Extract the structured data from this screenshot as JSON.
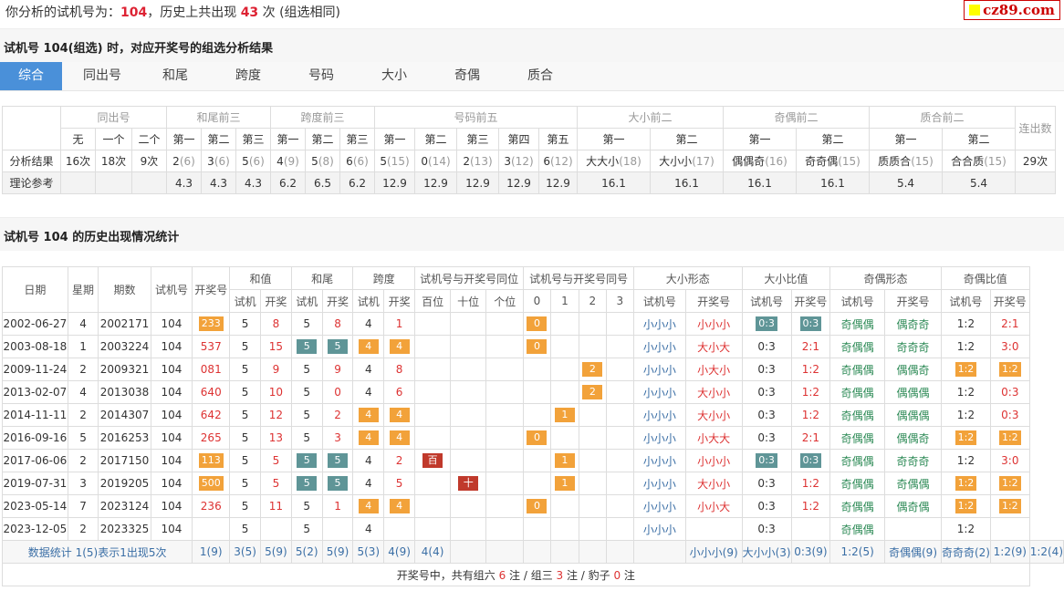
{
  "header": {
    "prefix": "你分析的试机号为：",
    "num": "104",
    "mid": "，历史上共出现 ",
    "count": "43",
    "suffix": " 次 (组选相同)"
  },
  "logo": "cz89.com",
  "section1_title": "试机号 104(组选) 时，对应开奖号的组选分析结果",
  "tabs": [
    "综合",
    "同出号",
    "和尾",
    "跨度",
    "号码",
    "大小",
    "奇偶",
    "质合"
  ],
  "analysis": {
    "groups": [
      "同出号",
      "和尾前三",
      "跨度前三",
      "号码前五",
      "大小前二",
      "奇偶前二",
      "质合前二",
      "连出数"
    ],
    "sub": [
      "无",
      "一个",
      "二个",
      "第一",
      "第二",
      "第三",
      "第一",
      "第二",
      "第三",
      "第一",
      "第二",
      "第三",
      "第四",
      "第五",
      "第一",
      "第二",
      "第一",
      "第二",
      "第一",
      "第二"
    ],
    "row1_label": "分析结果",
    "row1": [
      [
        "16次",
        ""
      ],
      [
        "18次",
        ""
      ],
      [
        "9次",
        ""
      ],
      [
        "2",
        "(6)"
      ],
      [
        "3",
        "(6)"
      ],
      [
        "5",
        "(6)"
      ],
      [
        "4",
        "(9)"
      ],
      [
        "5",
        "(8)"
      ],
      [
        "6",
        "(6)"
      ],
      [
        "5",
        "(15)"
      ],
      [
        "0",
        "(14)"
      ],
      [
        "2",
        "(13)"
      ],
      [
        "3",
        "(12)"
      ],
      [
        "6",
        "(12)"
      ],
      [
        "大大小",
        "(18)"
      ],
      [
        "大小小",
        "(17)"
      ],
      [
        "偶偶奇",
        "(16)"
      ],
      [
        "奇奇偶",
        "(15)"
      ],
      [
        "质质合",
        "(15)"
      ],
      [
        "合合质",
        "(15)"
      ],
      [
        "29次",
        ""
      ]
    ],
    "row2_label": "理论参考",
    "row2": [
      "",
      "",
      "",
      "4.3",
      "4.3",
      "4.3",
      "6.2",
      "6.5",
      "6.2",
      "12.9",
      "12.9",
      "12.9",
      "12.9",
      "12.9",
      "16.1",
      "16.1",
      "16.1",
      "16.1",
      "5.4",
      "5.4",
      ""
    ]
  },
  "section2_title": "试机号 104 的历史出现情况统计",
  "history": {
    "head1": [
      "日期",
      "星期",
      "期数",
      "试机号",
      "开奖号",
      "和值",
      "和尾",
      "跨度",
      "试机号与开奖号同位",
      "试机号与开奖号同号",
      "大小形态",
      "大小比值",
      "奇偶形态",
      "奇偶比值"
    ],
    "head2": [
      "试机",
      "开奖",
      "试机",
      "开奖",
      "试机",
      "开奖",
      "百位",
      "十位",
      "个位",
      "0",
      "1",
      "2",
      "3",
      "试机号",
      "开奖号",
      "试机号",
      "开奖号",
      "试机号",
      "开奖号",
      "试机号",
      "开奖号"
    ],
    "rows": [
      {
        "date": "2002-06-27",
        "wk": "4",
        "issue": "2002171",
        "sj": "104",
        "kj": "233",
        "kjb": 1,
        "hz": [
          "5",
          "8"
        ],
        "hw": [
          "5",
          "8"
        ],
        "hwb": 0,
        "kd": [
          "4",
          "1"
        ],
        "kdb": 0,
        "pos": [
          "",
          "",
          ""
        ],
        "same": [
          "0",
          "",
          "",
          ""
        ],
        "dx": [
          "小小小",
          "小小小"
        ],
        "dxr": [
          "0:3",
          "0:3"
        ],
        "dxrb": 1,
        "jo": [
          "奇偶偶",
          "偶奇奇"
        ],
        "jor": [
          "1:2",
          "2:1"
        ],
        "jorb": 0
      },
      {
        "date": "2003-08-18",
        "wk": "1",
        "issue": "2003224",
        "sj": "104",
        "kj": "537",
        "kjb": 0,
        "hz": [
          "5",
          "15"
        ],
        "hw": [
          "5",
          "5"
        ],
        "hwb": 1,
        "kd": [
          "4",
          "4"
        ],
        "kdb": 1,
        "pos": [
          "",
          "",
          ""
        ],
        "same": [
          "0",
          "",
          "",
          ""
        ],
        "dx": [
          "小小小",
          "大小大"
        ],
        "dxr": [
          "0:3",
          "2:1"
        ],
        "dxrb": 0,
        "jo": [
          "奇偶偶",
          "奇奇奇"
        ],
        "jor": [
          "1:2",
          "3:0"
        ],
        "jorb": 0
      },
      {
        "date": "2009-11-24",
        "wk": "2",
        "issue": "2009321",
        "sj": "104",
        "kj": "081",
        "kjb": 0,
        "hz": [
          "5",
          "9"
        ],
        "hw": [
          "5",
          "9"
        ],
        "hwb": 0,
        "kd": [
          "4",
          "8"
        ],
        "kdb": 0,
        "pos": [
          "",
          "",
          ""
        ],
        "same": [
          "",
          "",
          "2",
          ""
        ],
        "dx": [
          "小小小",
          "小大小"
        ],
        "dxr": [
          "0:3",
          "1:2"
        ],
        "dxrb": 0,
        "jo": [
          "奇偶偶",
          "偶偶奇"
        ],
        "jor": [
          "1:2",
          "1:2"
        ],
        "jorb": 1
      },
      {
        "date": "2013-02-07",
        "wk": "4",
        "issue": "2013038",
        "sj": "104",
        "kj": "640",
        "kjb": 0,
        "hz": [
          "5",
          "10"
        ],
        "hw": [
          "5",
          "0"
        ],
        "hwb": 0,
        "kd": [
          "4",
          "6"
        ],
        "kdb": 0,
        "pos": [
          "",
          "",
          ""
        ],
        "same": [
          "",
          "",
          "2",
          ""
        ],
        "dx": [
          "小小小",
          "大小小"
        ],
        "dxr": [
          "0:3",
          "1:2"
        ],
        "dxrb": 0,
        "jo": [
          "奇偶偶",
          "偶偶偶"
        ],
        "jor": [
          "1:2",
          "0:3"
        ],
        "jorb": 0
      },
      {
        "date": "2014-11-11",
        "wk": "2",
        "issue": "2014307",
        "sj": "104",
        "kj": "642",
        "kjb": 0,
        "hz": [
          "5",
          "12"
        ],
        "hw": [
          "5",
          "2"
        ],
        "hwb": 0,
        "kd": [
          "4",
          "4"
        ],
        "kdb": 1,
        "pos": [
          "",
          "",
          ""
        ],
        "same": [
          "",
          "1",
          "",
          ""
        ],
        "dx": [
          "小小小",
          "大小小"
        ],
        "dxr": [
          "0:3",
          "1:2"
        ],
        "dxrb": 0,
        "jo": [
          "奇偶偶",
          "偶偶偶"
        ],
        "jor": [
          "1:2",
          "0:3"
        ],
        "jorb": 0
      },
      {
        "date": "2016-09-16",
        "wk": "5",
        "issue": "2016253",
        "sj": "104",
        "kj": "265",
        "kjb": 0,
        "hz": [
          "5",
          "13"
        ],
        "hw": [
          "5",
          "3"
        ],
        "hwb": 0,
        "kd": [
          "4",
          "4"
        ],
        "kdb": 1,
        "pos": [
          "",
          "",
          ""
        ],
        "same": [
          "0",
          "",
          "",
          ""
        ],
        "dx": [
          "小小小",
          "小大大"
        ],
        "dxr": [
          "0:3",
          "2:1"
        ],
        "dxrb": 0,
        "jo": [
          "奇偶偶",
          "偶偶奇"
        ],
        "jor": [
          "1:2",
          "1:2"
        ],
        "jorb": 1
      },
      {
        "date": "2017-06-06",
        "wk": "2",
        "issue": "2017150",
        "sj": "104",
        "kj": "113",
        "kjb": 1,
        "hz": [
          "5",
          "5"
        ],
        "hw": [
          "5",
          "5"
        ],
        "hwb": 1,
        "kd": [
          "4",
          "2"
        ],
        "kdb": 0,
        "pos": [
          "百",
          "",
          ""
        ],
        "same": [
          "",
          "1",
          "",
          ""
        ],
        "dx": [
          "小小小",
          "小小小"
        ],
        "dxr": [
          "0:3",
          "0:3"
        ],
        "dxrb": 1,
        "jo": [
          "奇偶偶",
          "奇奇奇"
        ],
        "jor": [
          "1:2",
          "3:0"
        ],
        "jorb": 0
      },
      {
        "date": "2019-07-31",
        "wk": "3",
        "issue": "2019205",
        "sj": "104",
        "kj": "500",
        "kjb": 1,
        "hz": [
          "5",
          "5"
        ],
        "hw": [
          "5",
          "5"
        ],
        "hwb": 1,
        "kd": [
          "4",
          "5"
        ],
        "kdb": 0,
        "pos": [
          "",
          "十",
          ""
        ],
        "same": [
          "",
          "1",
          "",
          ""
        ],
        "dx": [
          "小小小",
          "大小小"
        ],
        "dxr": [
          "0:3",
          "1:2"
        ],
        "dxrb": 0,
        "jo": [
          "奇偶偶",
          "奇偶偶"
        ],
        "jor": [
          "1:2",
          "1:2"
        ],
        "jorb": 1
      },
      {
        "date": "2023-05-14",
        "wk": "7",
        "issue": "2023124",
        "sj": "104",
        "kj": "236",
        "kjb": 0,
        "hz": [
          "5",
          "11"
        ],
        "hw": [
          "5",
          "1"
        ],
        "hwb": 0,
        "kd": [
          "4",
          "4"
        ],
        "kdb": 1,
        "pos": [
          "",
          "",
          ""
        ],
        "same": [
          "0",
          "",
          "",
          ""
        ],
        "dx": [
          "小小小",
          "小小大"
        ],
        "dxr": [
          "0:3",
          "1:2"
        ],
        "dxrb": 0,
        "jo": [
          "奇偶偶",
          "偶奇偶"
        ],
        "jor": [
          "1:2",
          "1:2"
        ],
        "jorb": 1
      },
      {
        "date": "2023-12-05",
        "wk": "2",
        "issue": "2023325",
        "sj": "104",
        "kj": "",
        "kjb": 0,
        "hz": [
          "5",
          ""
        ],
        "hw": [
          "5",
          ""
        ],
        "hwb": 0,
        "kd": [
          "4",
          ""
        ],
        "kdb": 0,
        "pos": [
          "",
          "",
          ""
        ],
        "same": [
          "",
          "",
          "",
          ""
        ],
        "dx": [
          "小小小",
          ""
        ],
        "dxr": [
          "0:3",
          ""
        ],
        "dxrb": 0,
        "jo": [
          "奇偶偶",
          ""
        ],
        "jor": [
          "1:2",
          ""
        ],
        "jorb": 0
      }
    ],
    "summary": [
      "数据统计 1(5)表示1出现5次",
      "1(9)",
      "3(5)",
      "5(9)",
      "5(2)",
      "5(9)",
      "5(3)",
      "4(9)",
      "4(4)",
      "",
      "",
      "",
      "",
      "",
      "",
      "",
      "小小小(9)",
      "大小小(3)",
      "0:3(9)",
      "1:2(5)",
      "奇偶偶(9)",
      "奇奇奇(2)",
      "1:2(9)",
      "1:2(4)"
    ],
    "footer": {
      "a": "开奖号中，共有组六 ",
      "n1": "6",
      "b": " 注 / 组三 ",
      "n2": "3",
      "c": " 注 / 豹子 ",
      "n3": "0",
      "d": " 注"
    }
  },
  "colors": {
    "accent": "#4a90d9",
    "badge_orange": "#f2a23a",
    "badge_teal": "#5f9597",
    "badge_red": "#c0392b",
    "highlight": "#dd2233"
  }
}
